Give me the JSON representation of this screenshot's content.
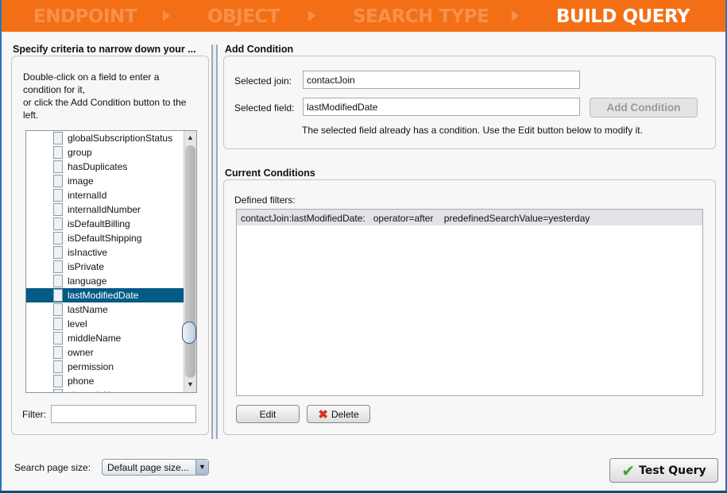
{
  "wizard": {
    "steps": [
      "ENDPOINT",
      "OBJECT",
      "SEARCH TYPE",
      "BUILD QUERY"
    ],
    "active_step": "BUILD QUERY"
  },
  "left": {
    "title": "Specify criteria to narrow down your ...",
    "instructions": [
      "Double-click on a field to enter a",
      "condition for it,",
      "or click the Add Condition button to the",
      "left."
    ],
    "fields": [
      "globalSubscriptionStatus",
      "group",
      "hasDuplicates",
      "image",
      "internalId",
      "internalIdNumber",
      "isDefaultBilling",
      "isDefaultShipping",
      "isInactive",
      "isPrivate",
      "language",
      "lastModifiedDate",
      "lastName",
      "level",
      "middleName",
      "owner",
      "permission",
      "phone",
      "phoneticName"
    ],
    "selected_field": "lastModifiedDate",
    "filter_label": "Filter:",
    "filter_value": ""
  },
  "add_condition": {
    "title": "Add Condition",
    "join_label": "Selected join:",
    "join_value": "contactJoin",
    "field_label": "Selected field:",
    "field_value": "lastModifiedDate",
    "button": "Add Condition",
    "message": "The selected field already has a condition. Use the Edit button below to modify it."
  },
  "current": {
    "title": "Current Conditions",
    "filters_label": "Defined filters:",
    "filters": [
      "contactJoin:lastModifiedDate:   operator=after    predefinedSearchValue=yesterday"
    ],
    "edit": "Edit",
    "delete": "Delete"
  },
  "footer": {
    "page_size_label": "Search page size:",
    "page_size_value": "Default page size...",
    "test_query": "Test Query"
  },
  "colors": {
    "header": "#f26f16",
    "selection": "#035a84",
    "window_border": "#2d74b4"
  }
}
